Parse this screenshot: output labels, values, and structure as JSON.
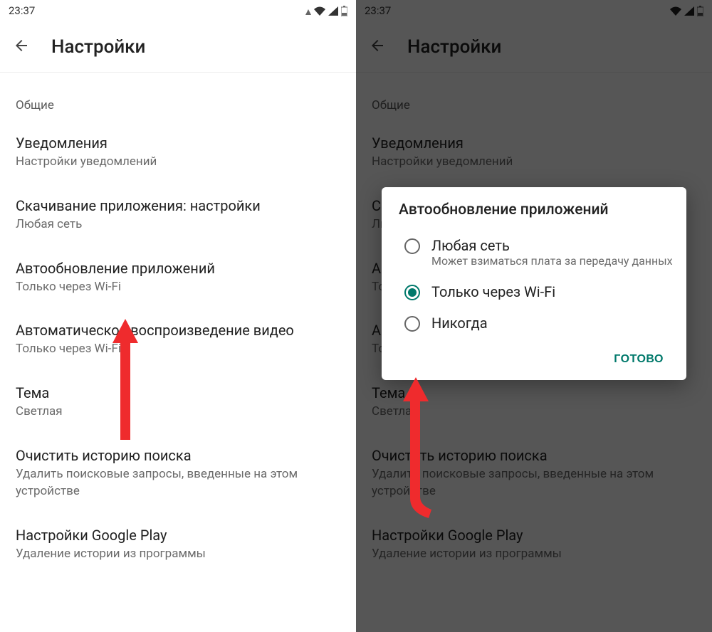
{
  "status": {
    "time": "23:37"
  },
  "topbar": {
    "title": "Настройки"
  },
  "section_general": "Общие",
  "items": {
    "notifications": {
      "title": "Уведомления",
      "sub": "Настройки уведомлений"
    },
    "download": {
      "title": "Скачивание приложения: настройки",
      "sub": "Любая сеть"
    },
    "autoupdate": {
      "title": "Автообновление приложений",
      "sub": "Только через Wi-Fi"
    },
    "autoplay": {
      "title": "Автоматическое воспроизведение видео",
      "sub": "Только через Wi-Fi"
    },
    "theme": {
      "title": "Тема",
      "sub": "Светлая"
    },
    "clear_history": {
      "title": "Очистить историю поиска",
      "sub": "Удалить поисковые запросы, введенные на этом устройстве"
    },
    "play_settings": {
      "title": "Настройки Google Play",
      "sub": "Удаление истории из программы"
    }
  },
  "dialog": {
    "title": "Автообновление приложений",
    "options": {
      "any": {
        "label": "Любая сеть",
        "sub": "Может взиматься плата за передачу данных"
      },
      "wifi": {
        "label": "Только через Wi-Fi"
      },
      "never": {
        "label": "Никогда"
      }
    },
    "done": "ГОТОВО"
  }
}
